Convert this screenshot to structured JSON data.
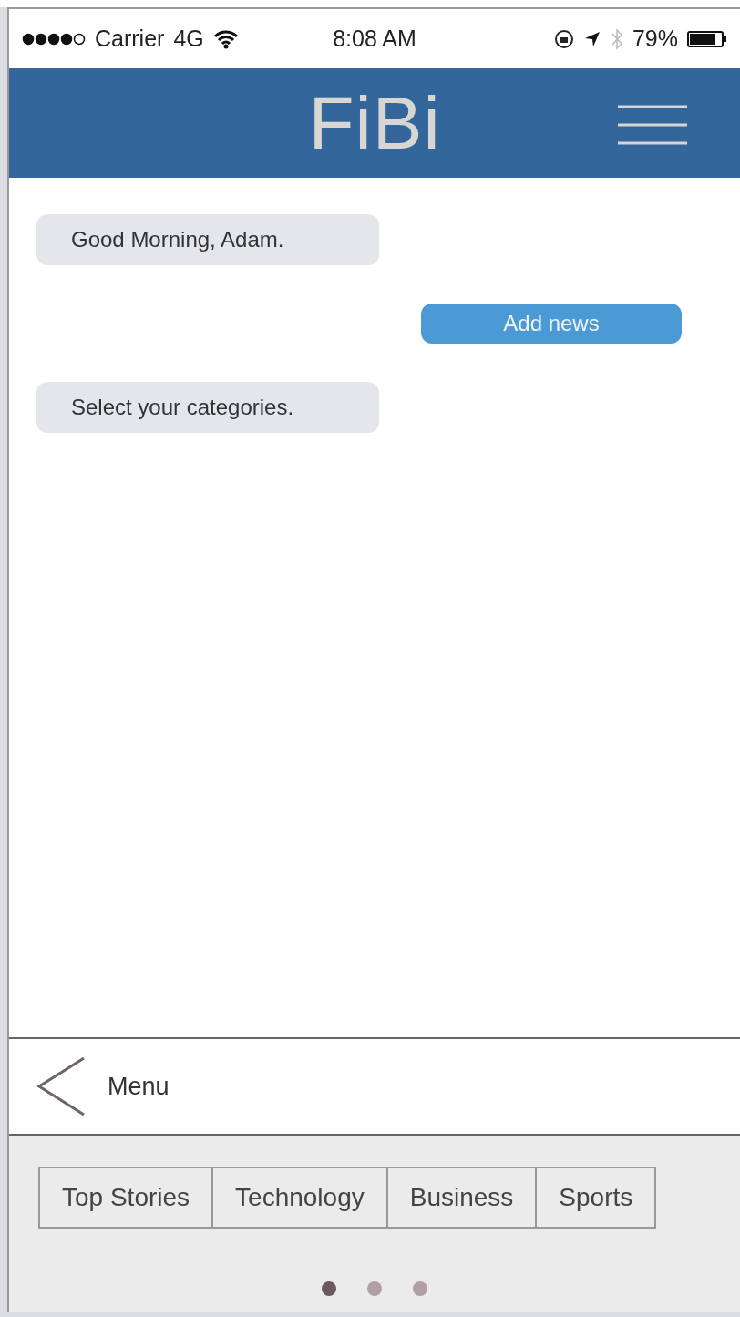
{
  "status_bar": {
    "carrier": "Carrier",
    "network": "4G",
    "time": "8:08 AM",
    "battery": "79%"
  },
  "header": {
    "title": "FiBi"
  },
  "messages": [
    {
      "kind": "incoming",
      "text": "Good Morning, Adam."
    },
    {
      "kind": "outgoing",
      "text": "Add news"
    },
    {
      "kind": "incoming",
      "text": "Select your categories."
    }
  ],
  "menu_bar": {
    "label": "Menu"
  },
  "categories": [
    {
      "label": "Top Stories"
    },
    {
      "label": "Technology"
    },
    {
      "label": "Business"
    },
    {
      "label": "Sports"
    }
  ],
  "pages": [
    {
      "selected": true
    },
    {
      "selected": false
    },
    {
      "selected": false
    }
  ]
}
